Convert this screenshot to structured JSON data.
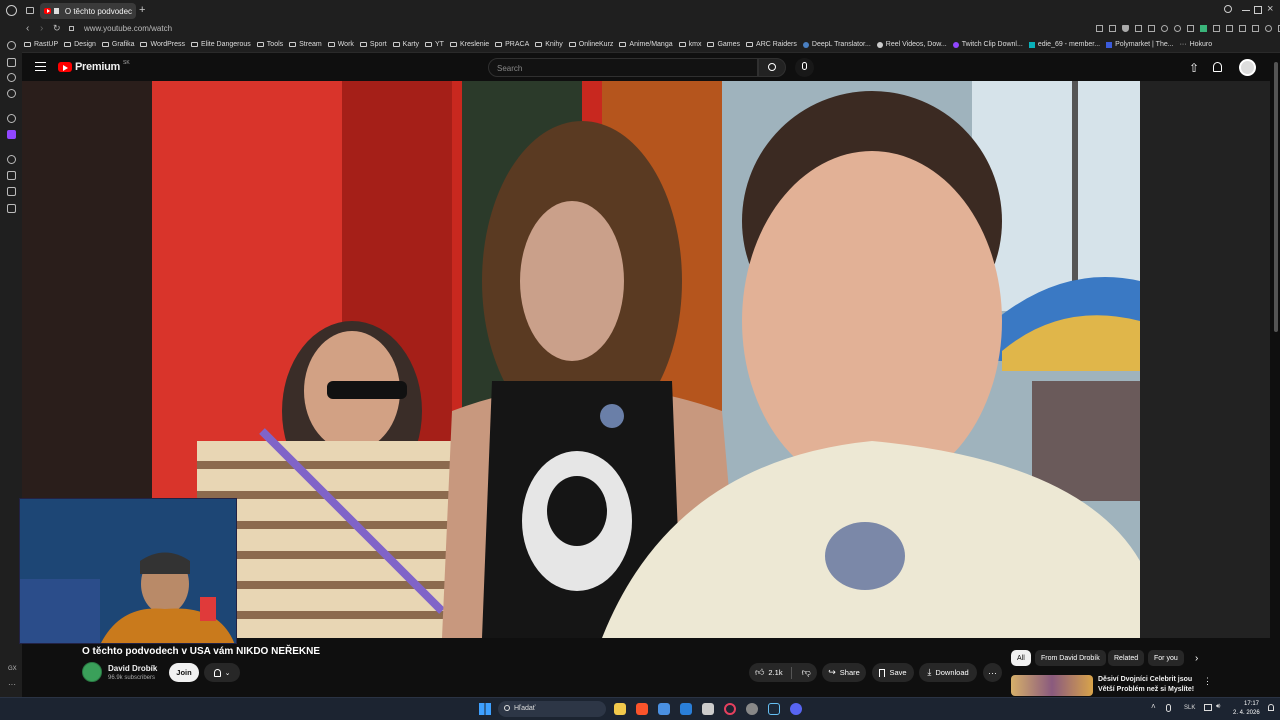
{
  "browser": {
    "tab_title": "O těchto podvodech v",
    "url": "www.youtube.com/watch",
    "bookmarks": [
      "RastUP",
      "Design",
      "Grafika",
      "WordPress",
      "Elite Dangerous",
      "Tools",
      "Stream",
      "Work",
      "Sport",
      "Karty",
      "YT",
      "Kreslenie",
      "PRACA",
      "Knihy",
      "OnlineKurz",
      "Anime/Manga",
      "kmx",
      "Games",
      "ARC Raiders",
      "DeepL Translator...",
      "Reel Videos, Dow...",
      "Twitch Clip Downl...",
      "edie_69 - member...",
      "Polymarket | The...",
      "Hokuro"
    ]
  },
  "youtube": {
    "logo_text": "Premium",
    "region": "SK",
    "search_placeholder": "Search"
  },
  "video": {
    "title": "O těchto podvodech v USA vám NIKDO NEŘEKNE",
    "channel_name": "David Drobík",
    "subscribers": "96.9k subscribers",
    "join_label": "Join",
    "likes": "2.1k",
    "share_label": "Share",
    "save_label": "Save",
    "download_label": "Download"
  },
  "chips": [
    "All",
    "From David Drobík",
    "Related",
    "For you"
  ],
  "recommended": {
    "title_line1": "Děsiví Dvojníci Celebrit jsou",
    "title_line2": "Větší Problém než si Myslíte!"
  },
  "sidebar_bottom": "GX",
  "taskbar": {
    "search_label": "Hľadať",
    "lang": "SLK",
    "time": "17:17",
    "date": "2. 4. 2026"
  },
  "colors": {
    "yt_red": "#ff0000",
    "bg": "#0f0f0f",
    "taskbar": "#1c2431"
  }
}
